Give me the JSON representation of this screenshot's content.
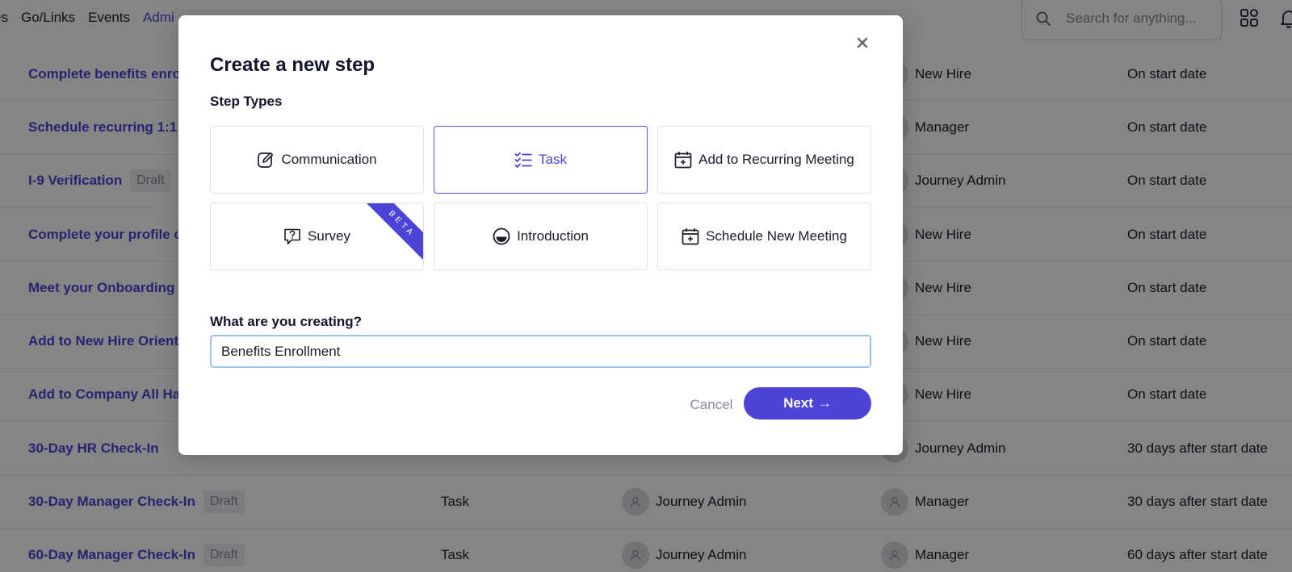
{
  "nav": {
    "items": [
      {
        "label": "es"
      },
      {
        "label": "Go/Links"
      },
      {
        "label": "Events"
      },
      {
        "label": "Admi",
        "active": true
      }
    ]
  },
  "search": {
    "placeholder": "Search for anything..."
  },
  "table": {
    "rows": [
      {
        "name": "Complete benefits enro",
        "draft": "",
        "type": "",
        "assignee": "",
        "owner": "New Hire",
        "due": "On start date"
      },
      {
        "name": "Schedule recurring 1:1",
        "draft": "",
        "type": "",
        "assignee": "",
        "owner": "Manager",
        "due": "On start date"
      },
      {
        "name": "I-9 Verification",
        "draft": "Draft",
        "type": "",
        "assignee": "",
        "owner": "Journey Admin",
        "due": "On start date"
      },
      {
        "name": "Complete your profile o",
        "draft": "",
        "type": "",
        "assignee": "",
        "owner": "New Hire",
        "due": "On start date"
      },
      {
        "name": "Meet your Onboarding",
        "draft": "",
        "type": "",
        "assignee": "",
        "owner": "New Hire",
        "due": "On start date"
      },
      {
        "name": "Add to New Hire Orient",
        "draft": "",
        "type": "",
        "assignee": "",
        "owner": "New Hire",
        "due": "On start date"
      },
      {
        "name": "Add to Company All Ha",
        "draft": "",
        "type": "",
        "assignee": "",
        "owner": "New Hire",
        "due": "On start date"
      },
      {
        "name": "30-Day HR Check-In",
        "draft": "",
        "type": "",
        "assignee": "",
        "owner": "Journey Admin",
        "due": "30 days after start date"
      },
      {
        "name": "30-Day Manager Check-In",
        "draft": "Draft",
        "type": "Task",
        "assignee": "Journey Admin",
        "owner": "Manager",
        "due": "30 days after start date"
      },
      {
        "name": "60-Day Manager Check-In",
        "draft": "Draft",
        "type": "Task",
        "assignee": "Journey Admin",
        "owner": "Manager",
        "due": "60 days after start date"
      }
    ]
  },
  "modal": {
    "title": "Create a new step",
    "step_types_label": "Step Types",
    "types": [
      {
        "label": "Communication",
        "icon": "edit-icon"
      },
      {
        "label": "Task",
        "icon": "checklist-icon",
        "selected": true
      },
      {
        "label": "Add to Recurring Meeting",
        "icon": "calendar-add-icon"
      },
      {
        "label": "Survey",
        "icon": "question-bubble-icon",
        "badge": "BETA"
      },
      {
        "label": "Introduction",
        "icon": "smile-icon"
      },
      {
        "label": "Schedule New Meeting",
        "icon": "calendar-add-icon"
      }
    ],
    "input_label": "What are you creating?",
    "input_value": "Benefits Enrollment",
    "cancel_label": "Cancel",
    "next_label": "Next",
    "next_arrow": "→"
  },
  "colors": {
    "accent": "#4b44d6",
    "overlay": "rgba(0,0,0,0.48)"
  }
}
